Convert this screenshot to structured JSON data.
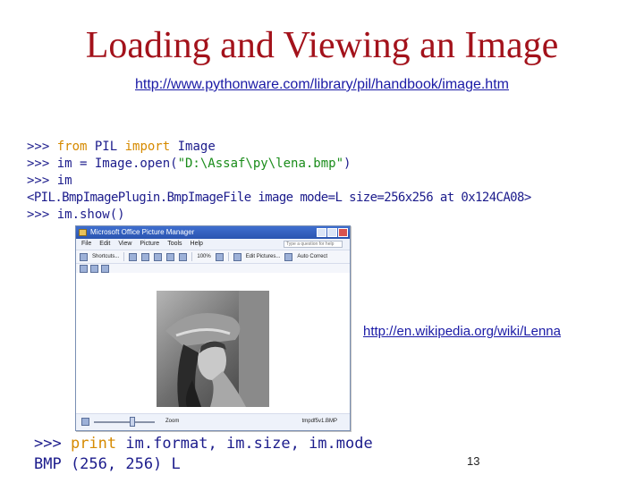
{
  "slide": {
    "title": "Loading and Viewing an Image",
    "url_top": "http://www.pythonware.com/library/pil/handbook/image.htm",
    "url_side": "http://en.wikipedia.org/wiki/Lenna",
    "page_number": "13"
  },
  "code": {
    "line1": {
      "prompt": ">>> ",
      "kw_from": "from",
      "mid": " PIL ",
      "kw_import": "import",
      "rest": " Image"
    },
    "line2": {
      "prompt": ">>> ",
      "pre": "im = Image.open(",
      "str": "\"D:\\Assaf\\py\\lena.bmp\"",
      "post": ")"
    },
    "line3": {
      "text": ">>> im"
    },
    "line4": {
      "text": "<PIL.BmpImagePlugin.BmpImageFile image mode=L size=256x256 at 0x124CA08>"
    },
    "line5": {
      "text": ">>> im.show()"
    },
    "line6": {
      "prompt": ">>> ",
      "kw": "print",
      "rest": " im.format, im.size, im.mode"
    },
    "line7": {
      "text": "BMP (256, 256) L"
    }
  },
  "viewer": {
    "window_title": "Microsoft Office Picture Manager",
    "menus": [
      "File",
      "Edit",
      "View",
      "Picture",
      "Tools",
      "Help"
    ],
    "help_placeholder": "Type a question for help",
    "toolbar": {
      "shortcuts": "Shortcuts...",
      "zoom": "100%",
      "edit_pictures": "Edit Pictures...",
      "auto_correct": "Auto Correct"
    },
    "status_zoom": "Zoom",
    "status_file": "tmpdf5v1.BMP"
  },
  "colors": {
    "title": "#a3121b",
    "code": "#1c1c8c",
    "keyword": "#d68a00",
    "string": "#1a8c1a",
    "link": "#1a1aa6"
  }
}
